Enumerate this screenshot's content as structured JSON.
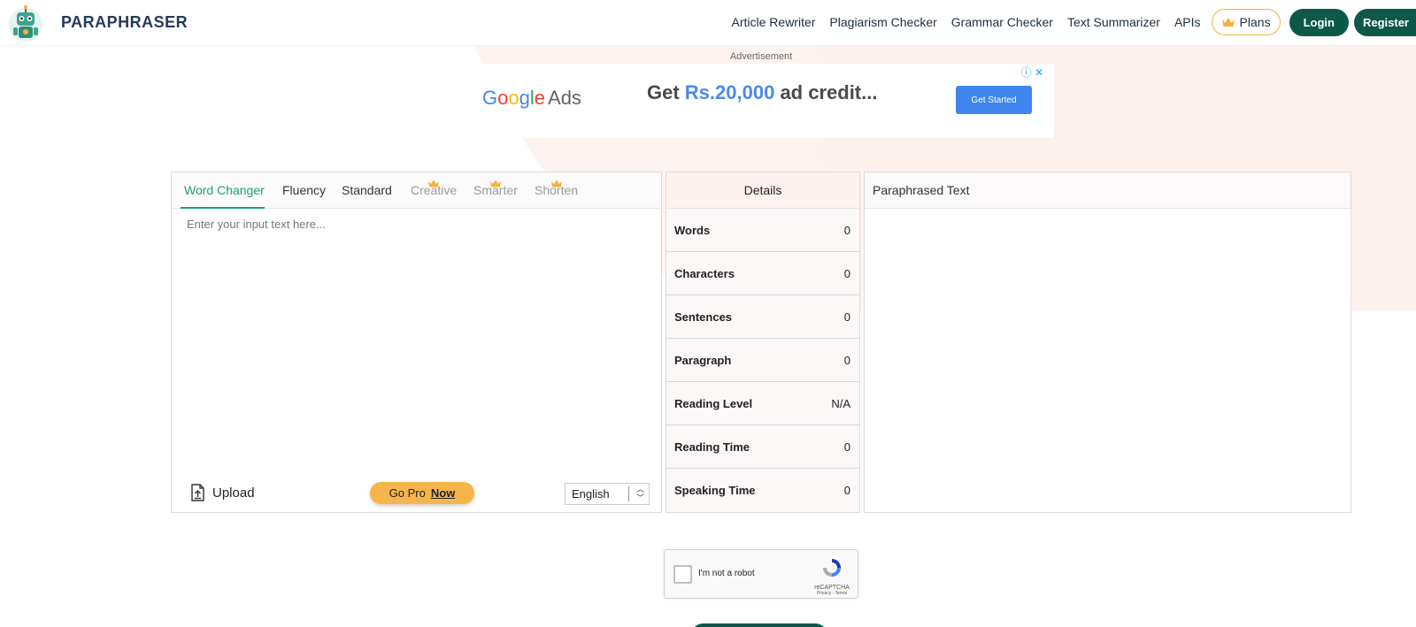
{
  "header": {
    "brand": "PARAPHRASER",
    "nav": [
      "Article Rewriter",
      "Plagiarism Checker",
      "Grammar Checker",
      "Text Summarizer",
      "APIs"
    ],
    "plans_label": "Plans",
    "login_label": "Login",
    "register_label": "Register"
  },
  "ad": {
    "label": "Advertisement",
    "brand_ads": "Ads",
    "headline_prefix": "Get ",
    "headline_accent": "Rs.20,000",
    "headline_suffix": " ad credit...",
    "cta": "Get Started"
  },
  "input_panel": {
    "tabs": [
      {
        "label": "Word Changer",
        "active": true,
        "premium": false
      },
      {
        "label": "Fluency",
        "active": false,
        "premium": false
      },
      {
        "label": "Standard",
        "active": false,
        "premium": false
      },
      {
        "label": "Creative",
        "active": false,
        "premium": true
      },
      {
        "label": "Smarter",
        "active": false,
        "premium": true
      },
      {
        "label": "Shorten",
        "active": false,
        "premium": true
      }
    ],
    "placeholder": "Enter your input text here...",
    "upload_label": "Upload",
    "gopro_label": "Go Pro",
    "gopro_now": "Now",
    "language": "English"
  },
  "details": {
    "title": "Details",
    "rows": [
      {
        "label": "Words",
        "value": "0"
      },
      {
        "label": "Characters",
        "value": "0"
      },
      {
        "label": "Sentences",
        "value": "0"
      },
      {
        "label": "Paragraph",
        "value": "0"
      },
      {
        "label": "Reading Level",
        "value": "N/A"
      },
      {
        "label": "Reading Time",
        "value": "0"
      },
      {
        "label": "Speaking Time",
        "value": "0"
      }
    ]
  },
  "output_panel": {
    "title": "Paraphrased Text"
  },
  "captcha": {
    "label": "I'm not a robot",
    "brand": "reCAPTCHA",
    "links": "Privacy - Terms"
  },
  "colors": {
    "brand_green": "#0d5849",
    "accent_teal": "#1b9e7b",
    "gold": "#f6b13e"
  }
}
